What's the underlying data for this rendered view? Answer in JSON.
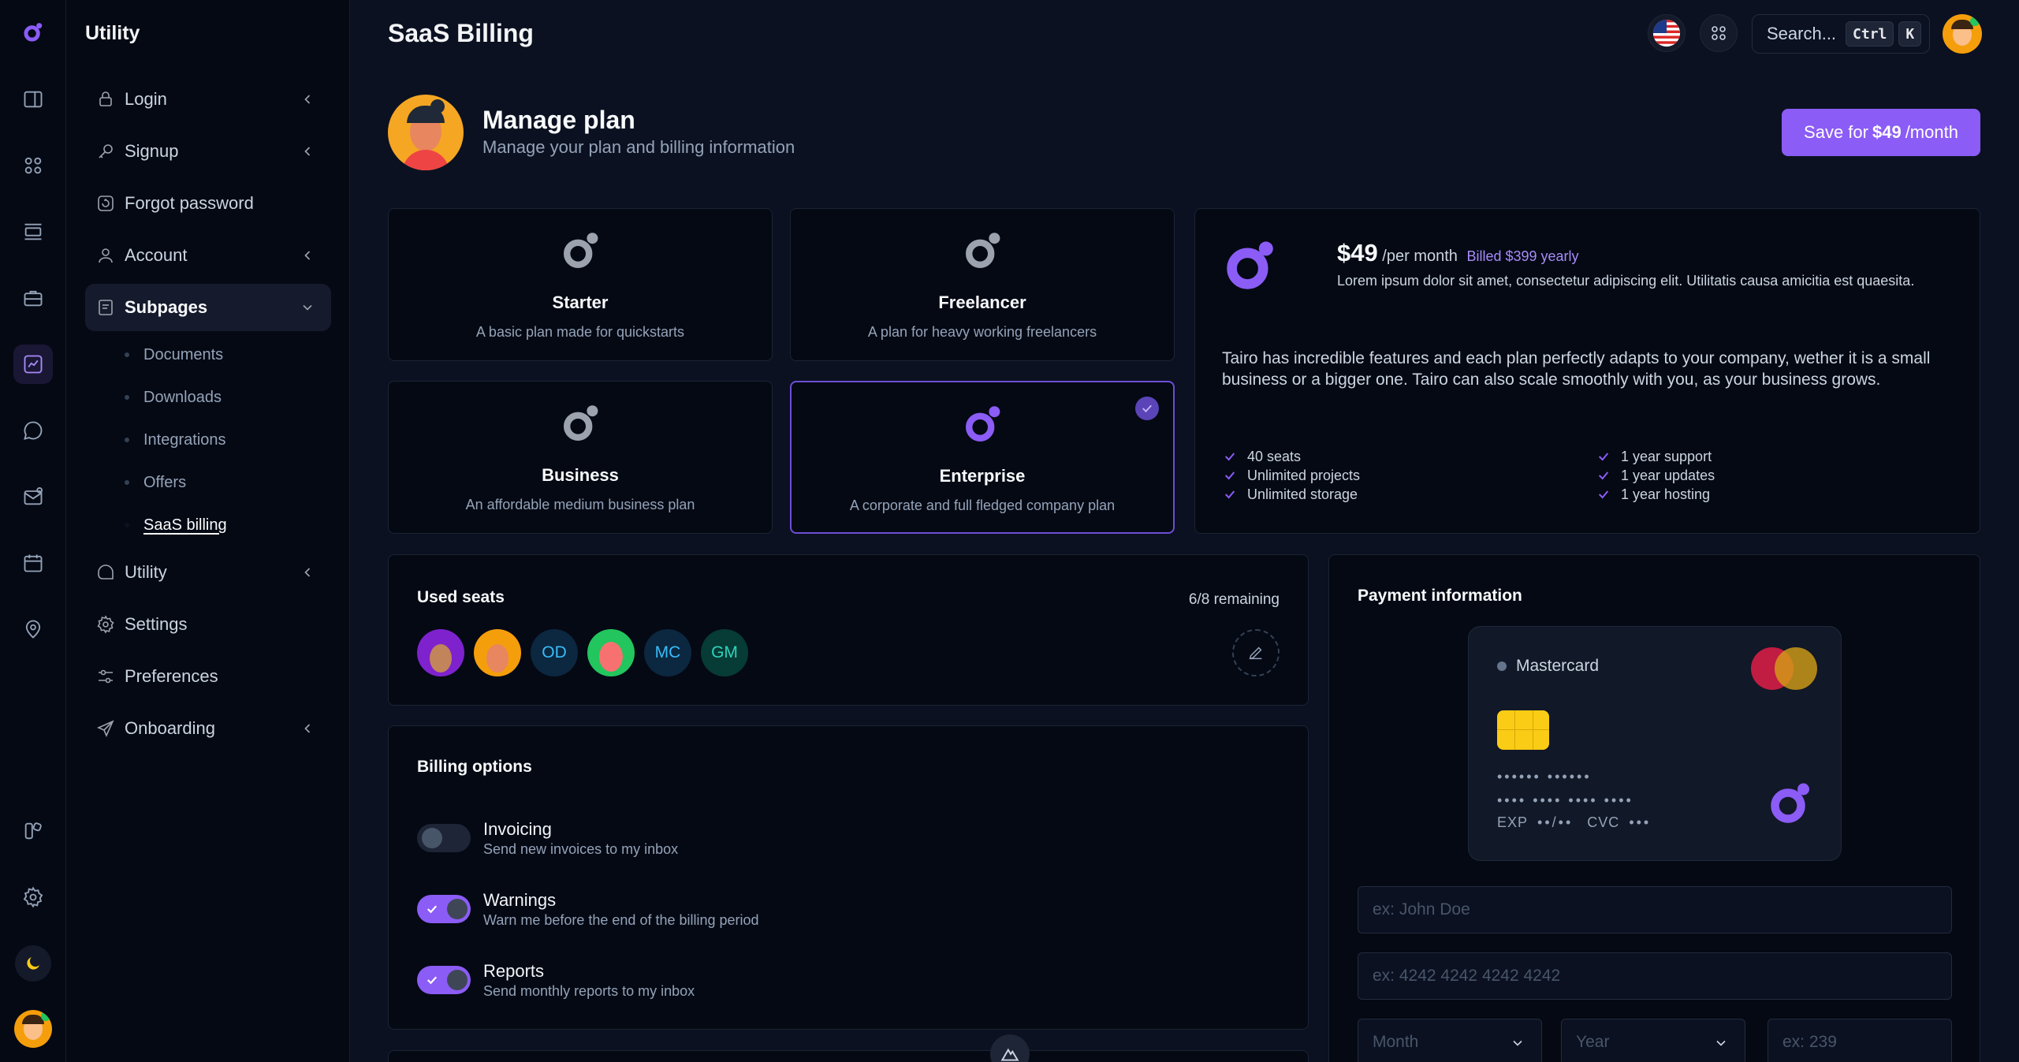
{
  "sidebar": {
    "title": "Utility",
    "items": [
      {
        "label": "Login"
      },
      {
        "label": "Signup"
      },
      {
        "label": "Forgot password"
      },
      {
        "label": "Account"
      },
      {
        "label": "Subpages"
      },
      {
        "label": "Utility"
      },
      {
        "label": "Settings"
      },
      {
        "label": "Preferences"
      },
      {
        "label": "Onboarding"
      }
    ],
    "subitems": [
      "Documents",
      "Downloads",
      "Integrations",
      "Offers",
      "SaaS billing"
    ]
  },
  "header": {
    "title": "SaaS Billing",
    "search_label": "Search...",
    "kbd_ctrl": "Ctrl",
    "kbd_k": "K"
  },
  "manage": {
    "title": "Manage plan",
    "subtitle": "Manage your plan and billing information",
    "save_prefix": "Save for",
    "save_price": "$49",
    "save_suffix": "/month"
  },
  "plans": [
    {
      "name": "Starter",
      "desc": "A basic plan made for quickstarts"
    },
    {
      "name": "Freelancer",
      "desc": "A plan for heavy working freelancers"
    },
    {
      "name": "Business",
      "desc": "An affordable medium business plan"
    },
    {
      "name": "Enterprise",
      "desc": "A corporate and full fledged company plan"
    }
  ],
  "detail": {
    "price": "$49",
    "per": "/per month",
    "billed": "Billed $399 yearly",
    "lorem": "Lorem ipsum dolor sit amet, consectetur adipiscing elit. Utilitatis causa amicitia est quaesita.",
    "text": "Tairo has incredible features and each plan perfectly adapts to your company, wether it is a small business or a bigger one. Tairo can also scale smoothly with you, as your business grows.",
    "features_left": [
      "40 seats",
      "Unlimited projects",
      "Unlimited storage"
    ],
    "features_right": [
      "1 year support",
      "1 year updates",
      "1 year hosting"
    ]
  },
  "seats": {
    "title": "Used seats",
    "remaining": "6/8 remaining",
    "initials": [
      "OD",
      "MC",
      "GM"
    ]
  },
  "billing": {
    "title": "Billing options",
    "options": [
      {
        "label": "Invoicing",
        "desc": "Send new invoices to my inbox",
        "on": false
      },
      {
        "label": "Warnings",
        "desc": "Warn me before the end of the billing period",
        "on": true
      },
      {
        "label": "Reports",
        "desc": "Send monthly reports to my inbox",
        "on": true
      }
    ]
  },
  "payment": {
    "title": "Payment information",
    "card_brand": "Mastercard",
    "card_line1": "•••••• ••••••",
    "card_line2": "•••• •••• •••• ••••",
    "card_exp_label": "EXP",
    "card_exp": "••/••",
    "card_cvc_label": "CVC",
    "card_cvc": "•••",
    "name_placeholder": "ex: John Doe",
    "number_placeholder": "ex: 4242 4242 4242 4242",
    "month_label": "Month",
    "year_label": "Year",
    "cvc_placeholder": "ex: 239"
  },
  "colors": {
    "accent": "#8b5cf6",
    "background": "#0b1121",
    "card": "#050914"
  }
}
